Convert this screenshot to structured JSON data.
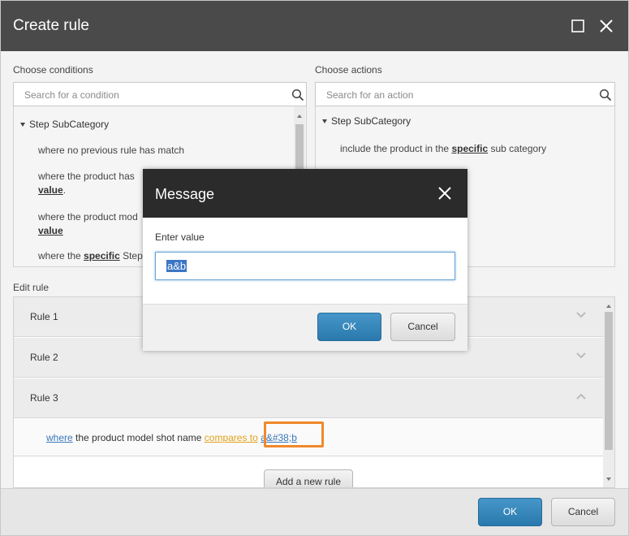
{
  "dialog": {
    "title": "Create rule",
    "icons": {
      "maximize": "maximize-icon",
      "close": "close-icon"
    }
  },
  "conditions": {
    "label": "Choose conditions",
    "search_placeholder": "Search for a condition",
    "group": "Step SubCategory",
    "items": [
      {
        "before": "where no previous rule has match",
        "kw": "",
        "after": ""
      },
      {
        "before": "where the product has",
        "kw": "",
        "after": ""
      },
      {
        "before": "where the product mod",
        "kw": "",
        "after": ""
      },
      {
        "before": "where the ",
        "kw": "specific",
        "after": " Step"
      }
    ],
    "trailing_value": "value",
    "trailing_dot": "."
  },
  "actions": {
    "label": "Choose actions",
    "search_placeholder": "Search for an action",
    "group": "Step SubCategory",
    "item_before": "include the product in the ",
    "item_kw": "specific",
    "item_after": " sub category"
  },
  "edit_rule": {
    "label": "Edit rule",
    "rules": [
      "Rule 1",
      "Rule 2",
      "Rule 3"
    ],
    "rule3_body": {
      "where": "where",
      "middle": " the product model shot name ",
      "compares": "compares to",
      "value": "a&#38;b"
    },
    "add_button": "Add a new rule"
  },
  "footer": {
    "ok": "OK",
    "cancel": "Cancel"
  },
  "modal": {
    "title": "Message",
    "prompt": "Enter value",
    "value": "a&b",
    "ok": "OK",
    "cancel": "Cancel"
  },
  "colors": {
    "titlebar": "#4a4a4a",
    "primary": "#2a79ad",
    "highlight": "#f0892b",
    "link_blue": "#3a78b9",
    "link_orange": "#e0a21c"
  }
}
